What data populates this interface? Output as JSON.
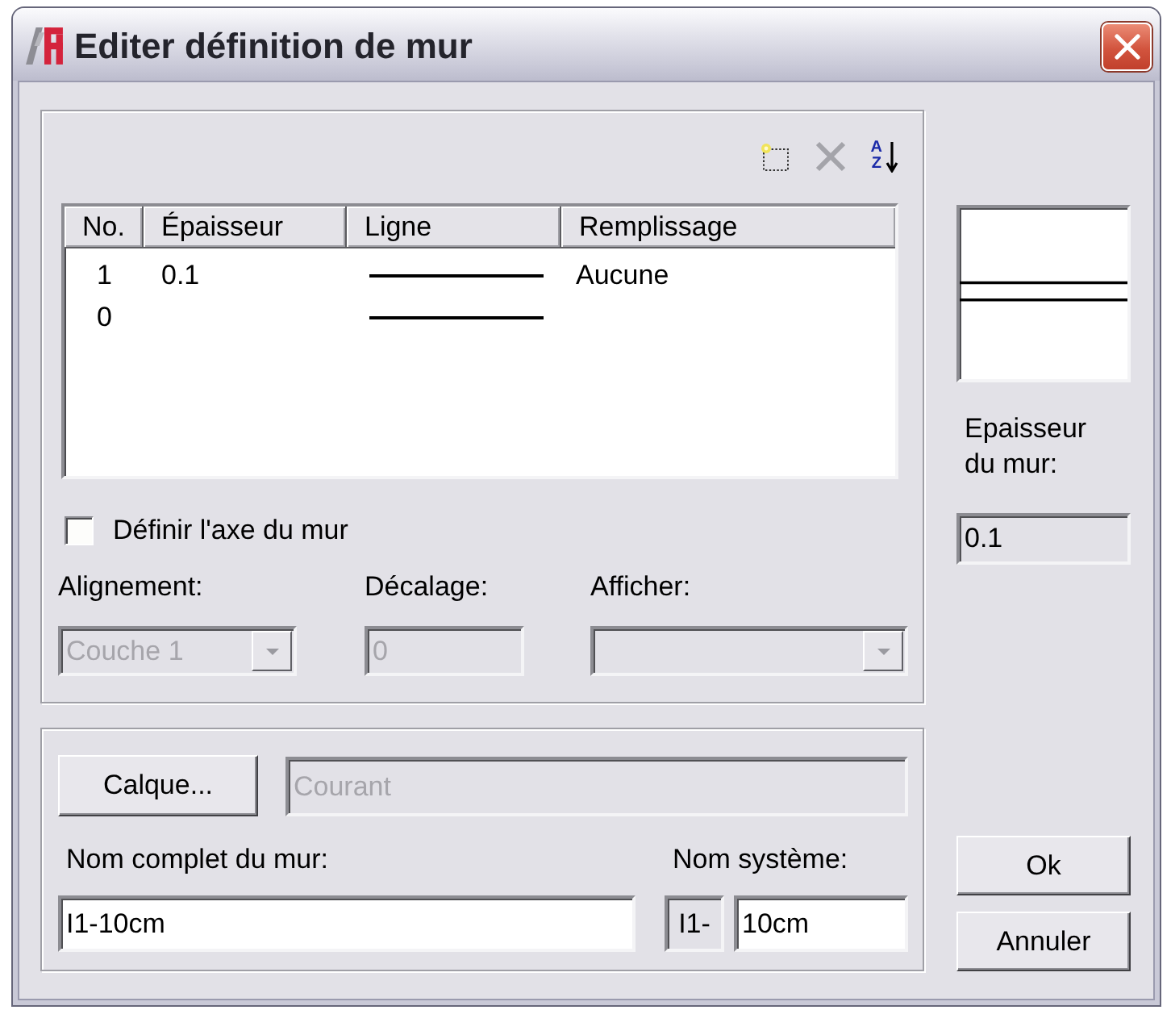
{
  "window": {
    "title": "Editer définition de mur"
  },
  "layers": {
    "toolbar": [
      {
        "kind": "new"
      },
      {
        "kind": "delete"
      },
      {
        "kind": "sort",
        "letters": [
          "A",
          "Z"
        ]
      }
    ],
    "table": {
      "columns": [
        "No.",
        "Épaisseur",
        "Ligne",
        "Remplissage"
      ],
      "rows": [
        {
          "no": "1",
          "thickness": "0.1",
          "line": true,
          "fill": "Aucune"
        },
        {
          "no": "0",
          "line": true
        }
      ]
    },
    "define_axis": {
      "label": "Définir l'axe du mur",
      "checked": false
    },
    "alignment": {
      "label": "Alignement:",
      "value": "Couche 1",
      "disabled": true
    },
    "offset": {
      "label": "Décalage:",
      "value": "0",
      "disabled": true
    },
    "display": {
      "label": "Afficher:",
      "disabled": true
    }
  },
  "layer": {
    "button": "Calque...",
    "value": "Courant",
    "disabled": true
  },
  "full_name": {
    "label": "Nom complet du mur:",
    "value": "I1-10cm"
  },
  "system_name": {
    "label": "Nom système:",
    "prefix": "I1-",
    "value": "10cm"
  },
  "thickness": {
    "label": "Epaisseur du mur:",
    "value": "0.1"
  },
  "buttons": [
    {
      "label": "Ok"
    },
    {
      "label": "Annuler"
    }
  ]
}
